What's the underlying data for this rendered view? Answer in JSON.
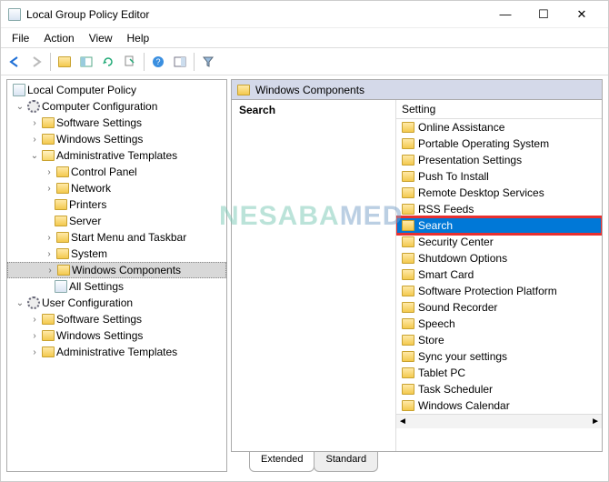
{
  "window": {
    "title": "Local Group Policy Editor",
    "controls": {
      "min": "—",
      "max": "☐",
      "close": "✕"
    }
  },
  "menubar": [
    "File",
    "Action",
    "View",
    "Help"
  ],
  "toolbar": {
    "back": "←",
    "forward": "→",
    "up": "up",
    "show": "show",
    "refresh": "↻",
    "export": "export",
    "help": "?",
    "showhide": "panel",
    "filter": "funnel"
  },
  "tree": {
    "root": {
      "label": "Local Computer Policy"
    },
    "computer_config": {
      "label": "Computer Configuration"
    },
    "cc_software": {
      "label": "Software Settings"
    },
    "cc_windows": {
      "label": "Windows Settings"
    },
    "cc_admin": {
      "label": "Administrative Templates"
    },
    "control_panel": {
      "label": "Control Panel"
    },
    "network": {
      "label": "Network"
    },
    "printers": {
      "label": "Printers"
    },
    "server": {
      "label": "Server"
    },
    "startmenu": {
      "label": "Start Menu and Taskbar"
    },
    "system": {
      "label": "System"
    },
    "win_components": {
      "label": "Windows Components"
    },
    "all_settings": {
      "label": "All Settings"
    },
    "user_config": {
      "label": "User Configuration"
    },
    "uc_software": {
      "label": "Software Settings"
    },
    "uc_windows": {
      "label": "Windows Settings"
    },
    "uc_admin": {
      "label": "Administrative Templates"
    }
  },
  "breadcrumb": "Windows Components",
  "desc_header": "Search",
  "list_header": "Setting",
  "settings": [
    "Online Assistance",
    "Portable Operating System",
    "Presentation Settings",
    "Push To Install",
    "Remote Desktop Services",
    "RSS Feeds",
    "Search",
    "Security Center",
    "Shutdown Options",
    "Smart Card",
    "Software Protection Platform",
    "Sound Recorder",
    "Speech",
    "Store",
    "Sync your settings",
    "Tablet PC",
    "Task Scheduler",
    "Windows Calendar"
  ],
  "selected_setting_index": 6,
  "tabs": {
    "extended": "Extended",
    "standard": "Standard"
  },
  "watermark": {
    "part1": "NESABA",
    "part2": "MED"
  }
}
